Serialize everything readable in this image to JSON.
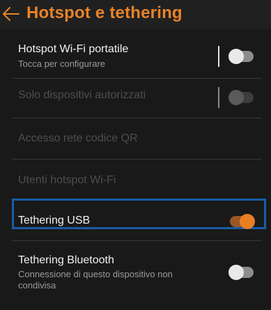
{
  "header": {
    "title": "Hotspot e tethering",
    "back_icon": "arrow-left-icon",
    "accent_color": "#e8832a"
  },
  "settings": [
    {
      "label": "Hotspot Wi-Fi portatile",
      "subtitle": "Tocca per configurare",
      "enabled": true,
      "toggle": "off"
    },
    {
      "label": "Solo dispositivi autorizzati",
      "enabled": false,
      "toggle": "off"
    },
    {
      "label": "Accesso rete codice QR",
      "enabled": false
    },
    {
      "label": "Utenti hotspot Wi-Fi",
      "enabled": false
    },
    {
      "label": "Tethering USB",
      "enabled": true,
      "toggle": "on",
      "focused": true
    },
    {
      "label": "Tethering Bluetooth",
      "subtitle": "Connessione di questo dispositivo non condivisa",
      "enabled": true,
      "toggle": "off"
    }
  ],
  "colors": {
    "background": "#191919",
    "toggle_on": "#e97d24",
    "focus_border": "#1a5ca8"
  }
}
